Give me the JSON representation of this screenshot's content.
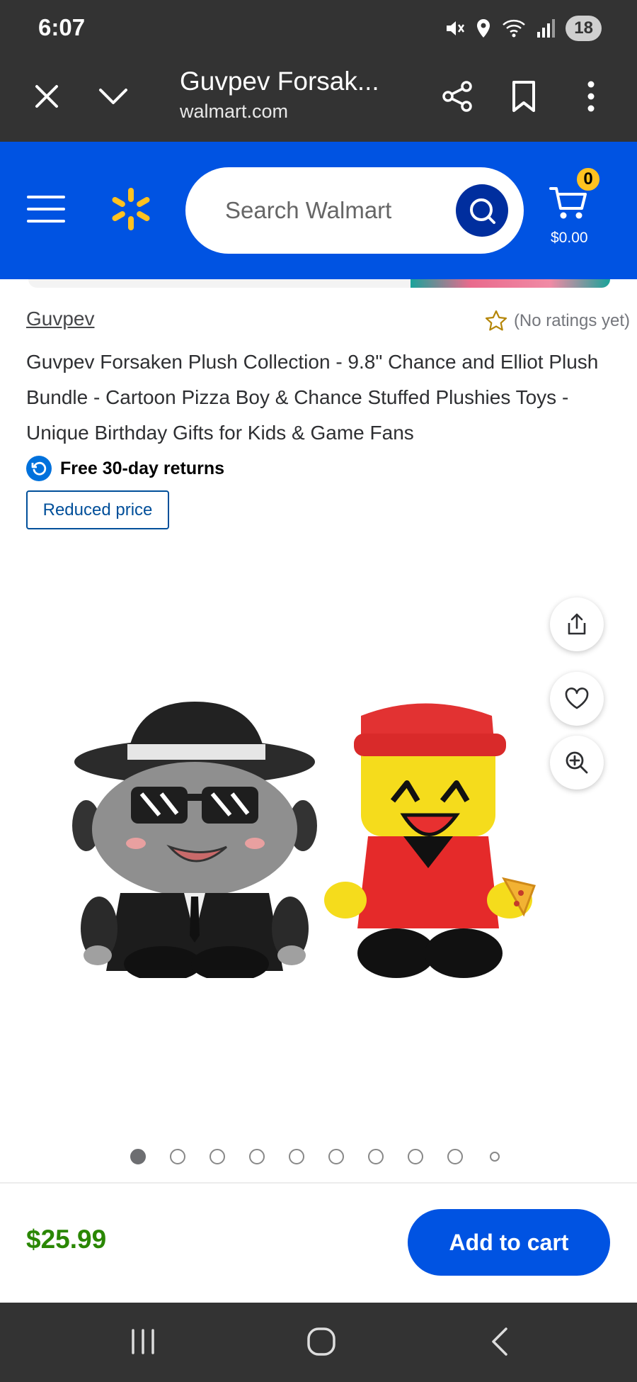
{
  "status_bar": {
    "time": "6:07",
    "battery": "18"
  },
  "browser": {
    "title": "Guvpev Forsak...",
    "domain": "walmart.com"
  },
  "header": {
    "search_placeholder": "Search Walmart",
    "cart_count": "0",
    "cart_total": "$0.00",
    "brand_color": "#0053e2",
    "spark_color": "#ffc220"
  },
  "product": {
    "brand": "Guvpev",
    "rating_text": "(No ratings yet)",
    "title": "Guvpev Forsaken Plush Collection - 9.8\" Chance and Elliot Plush Bundle - Cartoon Pizza Boy & Chance Stuffed Plushies Toys - Unique Birthday Gifts for Kids & Game Fans",
    "returns": "Free 30-day returns",
    "tag": "Reduced price",
    "image_alt": "Two plush toys: black fedora with sunglasses and yellow pizza boy with red cap",
    "image_count": 10,
    "active_image": 1,
    "price": "$25.99",
    "price_color": "#2a8703"
  },
  "actions": {
    "add_to_cart": "Add to cart"
  },
  "icons": [
    "close-icon",
    "chevron-down-icon",
    "share-icon",
    "bookmark-icon",
    "more-vertical-icon",
    "menu-icon",
    "walmart-spark-icon",
    "search-icon",
    "cart-icon",
    "star-icon",
    "returns-icon",
    "upload-icon",
    "heart-icon",
    "zoom-in-icon"
  ]
}
